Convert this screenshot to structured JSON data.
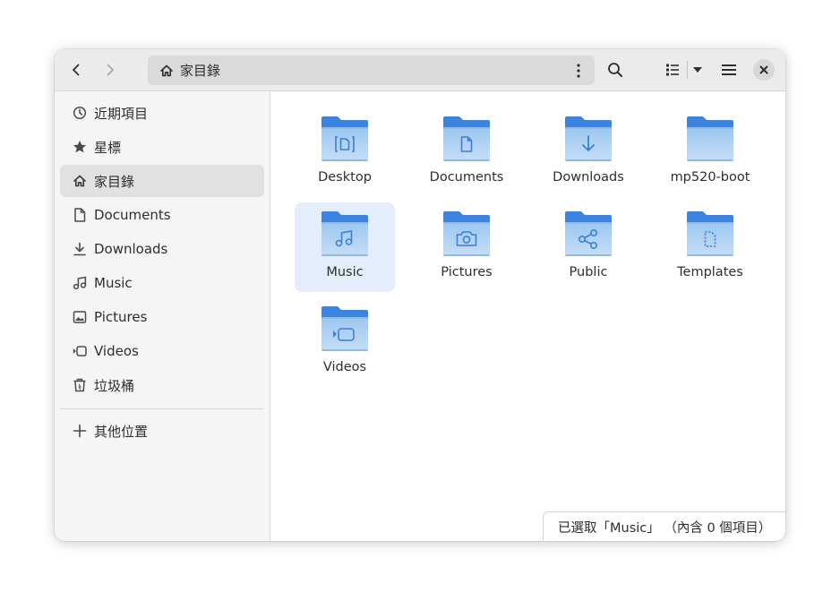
{
  "window": {
    "path_crumb": "家目錄"
  },
  "icons": {
    "back": "go-back-icon",
    "forward": "go-forward-icon",
    "home": "home-icon",
    "kebab": "path-menu-icon",
    "search": "search-icon",
    "list_view": "list-view-icon",
    "view_options": "chevron-down-icon",
    "main_menu": "hamburger-menu-icon",
    "close": "close-icon"
  },
  "sidebar": {
    "items": [
      {
        "label": "近期項目",
        "icon": "clock-icon"
      },
      {
        "label": "星標",
        "icon": "star-icon"
      },
      {
        "label": "家目錄",
        "icon": "home-icon",
        "active": true
      },
      {
        "label": "Documents",
        "icon": "document-icon"
      },
      {
        "label": "Downloads",
        "icon": "download-icon"
      },
      {
        "label": "Music",
        "icon": "music-icon"
      },
      {
        "label": "Pictures",
        "icon": "picture-icon"
      },
      {
        "label": "Videos",
        "icon": "video-icon"
      },
      {
        "label": "垃圾桶",
        "icon": "trash-icon"
      }
    ],
    "other_locations": {
      "label": "其他位置",
      "icon": "plus-icon"
    }
  },
  "files": [
    {
      "name": "Desktop",
      "icon": "folder-desktop-icon"
    },
    {
      "name": "Documents",
      "icon": "folder-documents-icon"
    },
    {
      "name": "Downloads",
      "icon": "folder-downloads-icon"
    },
    {
      "name": "mp520-boot",
      "icon": "folder-icon"
    },
    {
      "name": "Music",
      "icon": "folder-music-icon",
      "selected": true
    },
    {
      "name": "Pictures",
      "icon": "folder-pictures-icon"
    },
    {
      "name": "Public",
      "icon": "folder-public-icon"
    },
    {
      "name": "Templates",
      "icon": "folder-templates-icon"
    },
    {
      "name": "Videos",
      "icon": "folder-videos-icon"
    }
  ],
  "status": {
    "text": "已選取「Music」 （內含 0 個項目）"
  },
  "colors": {
    "folder_back": "#3c84e0",
    "folder_front_top": "#9cc6f0",
    "folder_front_bottom": "#c3dcf5",
    "folder_glyph": "#3b7fd6",
    "selection": "#e3edfb"
  }
}
